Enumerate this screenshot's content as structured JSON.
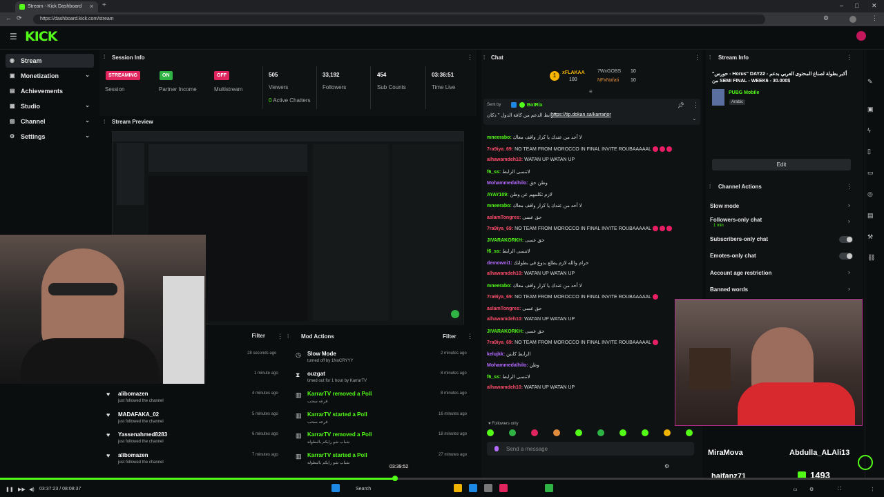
{
  "browser": {
    "tab_title": "Stream - Kick Dashboard",
    "url": "https://dashboard.kick.com/stream"
  },
  "app": {
    "logo": "KICK"
  },
  "sidebar": {
    "items": [
      {
        "label": "Stream",
        "icon": "broadcast-icon",
        "active": true
      },
      {
        "label": "Monetization",
        "icon": "dollar-icon",
        "chevron": true
      },
      {
        "label": "Achievements",
        "icon": "trophy-icon"
      },
      {
        "label": "Studio",
        "icon": "studio-icon",
        "chevron": true
      },
      {
        "label": "Channel",
        "icon": "channel-icon",
        "chevron": true
      },
      {
        "label": "Settings",
        "icon": "gear-icon",
        "chevron": true
      }
    ]
  },
  "session": {
    "title": "Session Info",
    "badges": [
      {
        "badge": "STREAMING",
        "label": "Session",
        "color": "#e0245e"
      },
      {
        "badge": "ON",
        "label": "Partner Income",
        "color": "#2fb344"
      },
      {
        "badge": "OFF",
        "label": "Multistream",
        "color": "#e0245e"
      }
    ],
    "stats": [
      {
        "value": "505",
        "label": "Viewers"
      },
      {
        "value": "33,192",
        "label": "Followers"
      },
      {
        "value": "454",
        "label": "Sub Counts"
      },
      {
        "value": "03:36:51",
        "label": "Time Live"
      }
    ],
    "active_chatters_value": "0",
    "active_chatters_label": "Active Chatters"
  },
  "preview": {
    "title": "Stream Preview"
  },
  "activity": {
    "filter_label": "Filter",
    "rows": [
      {
        "name": "",
        "sub": "",
        "time": "28 seconds ago"
      },
      {
        "name": "",
        "sub": "",
        "time": "1 minute ago"
      },
      {
        "name": "alibomazen",
        "sub": "just followed the channel",
        "time": "4 minutes ago"
      },
      {
        "name": "MADAFAKA_02",
        "sub": "just followed the channel",
        "time": "5 minutes ago"
      },
      {
        "name": "Yassenahmed8283",
        "sub": "just followed the channel",
        "time": "6 minutes ago"
      },
      {
        "name": "alibomazen",
        "sub": "just followed the channel",
        "time": "7 minutes ago"
      }
    ]
  },
  "mod_actions": {
    "title": "Mod Actions",
    "filter_label": "Filter",
    "rows": [
      {
        "title": "Slow Mode",
        "sub": "turned off by 1NoCRYYY",
        "time": "2 minutes ago"
      },
      {
        "title": "ouzgat",
        "sub": "timed out for 1 hour by KarrarTV",
        "time": "8 minutes ago"
      },
      {
        "title": "KarrarTV removed a Poll",
        "sub": "قرعه سحب",
        "time": "8 minutes ago"
      },
      {
        "title": "KarrarTV started a Poll",
        "sub": "قرعه سحب",
        "time": "16 minutes ago"
      },
      {
        "title": "KarrarTV removed a Poll",
        "sub": "شباب شو رايكم بالبطولة",
        "time": "18 minutes ago"
      },
      {
        "title": "KarrarTV started a Poll",
        "sub": "شباب شو رايكم بالبطولة",
        "time": "27 minutes ago"
      }
    ]
  },
  "chat": {
    "title": "Chat",
    "top_gifters": [
      {
        "name": "xFLAKAA",
        "count": "100"
      },
      {
        "name": "7WxGOBS",
        "count": "10"
      },
      {
        "name": "NFxNafati",
        "count": "10"
      }
    ],
    "pinned_sender": "Sent by",
    "pinned_bot": "BotRix",
    "pinned_text": "رابط الدعم من كافة الدول \" دكان \"",
    "pinned_link": "https://tip.dokan.sa/karrarjor",
    "messages": [
      {
        "user": "mneerabo:",
        "color": "#53fc18",
        "text": "لا أحد من عندك يا كرار واقف معاك",
        "emotes": 0
      },
      {
        "user": "7ra9iya_69:",
        "color": "#ff4d6a",
        "text": "NO TEAM FROM MOROCCO IN FINAL INVITE ROUBAAAAAL",
        "emotes": 3
      },
      {
        "user": "alhawamdeh10:",
        "color": "#ff4d6a",
        "text": "WATAN UP WATAN UP",
        "emotes": 0
      },
      {
        "user": "f6_ss:",
        "color": "#53fc18",
        "text": "لاتنسى الرابط",
        "emotes": 0
      },
      {
        "user": "Mohammedalhilo:",
        "color": "#b46cff",
        "text": "وطن حق",
        "emotes": 0
      },
      {
        "user": "AYAY109:",
        "color": "#53fc18",
        "text": "لازم تكلمهم عن وطن",
        "emotes": 0
      },
      {
        "user": "mneerabo:",
        "color": "#53fc18",
        "text": "لا أحد من عندك يا كرار واقف معاك",
        "emotes": 0
      },
      {
        "user": "aslamTongres:",
        "color": "#ff4d6a",
        "text": "حق عسى",
        "emotes": 0
      },
      {
        "user": "7ra9iya_69:",
        "color": "#ff4d6a",
        "text": "NO TEAM FROM MOROCCO IN FINAL INVITE ROUBAAAAAL",
        "emotes": 3
      },
      {
        "user": "JIVARAKORKH:",
        "color": "#53fc18",
        "text": "حق عسى",
        "emotes": 0
      },
      {
        "user": "f6_ss:",
        "color": "#53fc18",
        "text": "لاتنسى الرابط",
        "emotes": 0
      },
      {
        "user": "demowni1:",
        "color": "#b46cff",
        "text": "حرام والله لازم يطلع بدوع في بطولتك",
        "emotes": 0
      },
      {
        "user": "alhawamdeh10:",
        "color": "#ff4d6a",
        "text": "WATAN UP WATAN UP",
        "emotes": 0
      },
      {
        "user": "mneerabo:",
        "color": "#53fc18",
        "text": "لا أحد من عندك يا كرار واقف معاك",
        "emotes": 0
      },
      {
        "user": "7ra9iya_69:",
        "color": "#ff4d6a",
        "text": "NO TEAM FROM MOROCCO IN FINAL INVITE ROUBAAAAAL",
        "emotes": 1
      },
      {
        "user": "aslamTongres:",
        "color": "#ff4d6a",
        "text": "حق عسى",
        "emotes": 0
      },
      {
        "user": "alhawamdeh10:",
        "color": "#ff4d6a",
        "text": "WATAN UP WATAN UP",
        "emotes": 0
      },
      {
        "user": "JIVARAKORKH:",
        "color": "#53fc18",
        "text": "حق عسى",
        "emotes": 0
      },
      {
        "user": "7ra9iya_69:",
        "color": "#ff4d6a",
        "text": "NO TEAM FROM MOROCCO IN FINAL INVITE ROUBAAAAAL",
        "emotes": 1
      },
      {
        "user": "kelujkk:",
        "color": "#b46cff",
        "text": "الرابط كابتن",
        "emotes": 0
      },
      {
        "user": "Mohammedalhilo:",
        "color": "#b46cff",
        "text": "وطن",
        "emotes": 0
      },
      {
        "user": "f6_ss:",
        "color": "#53fc18",
        "text": "لاتنسى الرابط",
        "emotes": 0
      },
      {
        "user": "alhawamdeh10:",
        "color": "#ff4d6a",
        "text": "WATAN UP WATAN UP",
        "emotes": 0
      }
    ],
    "followers_only": "Followers only",
    "send_placeholder": "Send a message"
  },
  "stream_info": {
    "title": "Stream Info",
    "stream_title": "\"حورس - Horus\" DAY22 - أكبر بطولة لصناع المحتوى العربي بدعم من SEMI FINAL - WEEK6 - 30.000$",
    "category": "PUBG Mobile",
    "language": "Arabic",
    "edit_label": "Edit"
  },
  "channel_actions": {
    "title": "Channel Actions",
    "items": [
      {
        "label": "Slow mode",
        "sub": "",
        "control": "chevron"
      },
      {
        "label": "Followers-only chat",
        "sub": "1 min",
        "control": "chevron"
      },
      {
        "label": "Subscribers-only chat",
        "sub": "",
        "control": "toggle"
      },
      {
        "label": "Emotes-only chat",
        "sub": "",
        "control": "toggle"
      },
      {
        "label": "Account age restriction",
        "sub": "",
        "control": "chevron"
      },
      {
        "label": "Banned words",
        "sub": "",
        "control": "chevron"
      }
    ]
  },
  "overlay": {
    "names": [
      "MiraMova",
      "Abdulla_ALAli13",
      "haifanz71"
    ],
    "count": "1493"
  },
  "player": {
    "time": "03:37:23 / 08:08:37",
    "hover_time": "03:39:52",
    "progress": 0.4468,
    "search_label": "Search"
  },
  "colors": {
    "accent": "#53fc18",
    "live": "#e0245e",
    "panel": "#0f1213"
  }
}
